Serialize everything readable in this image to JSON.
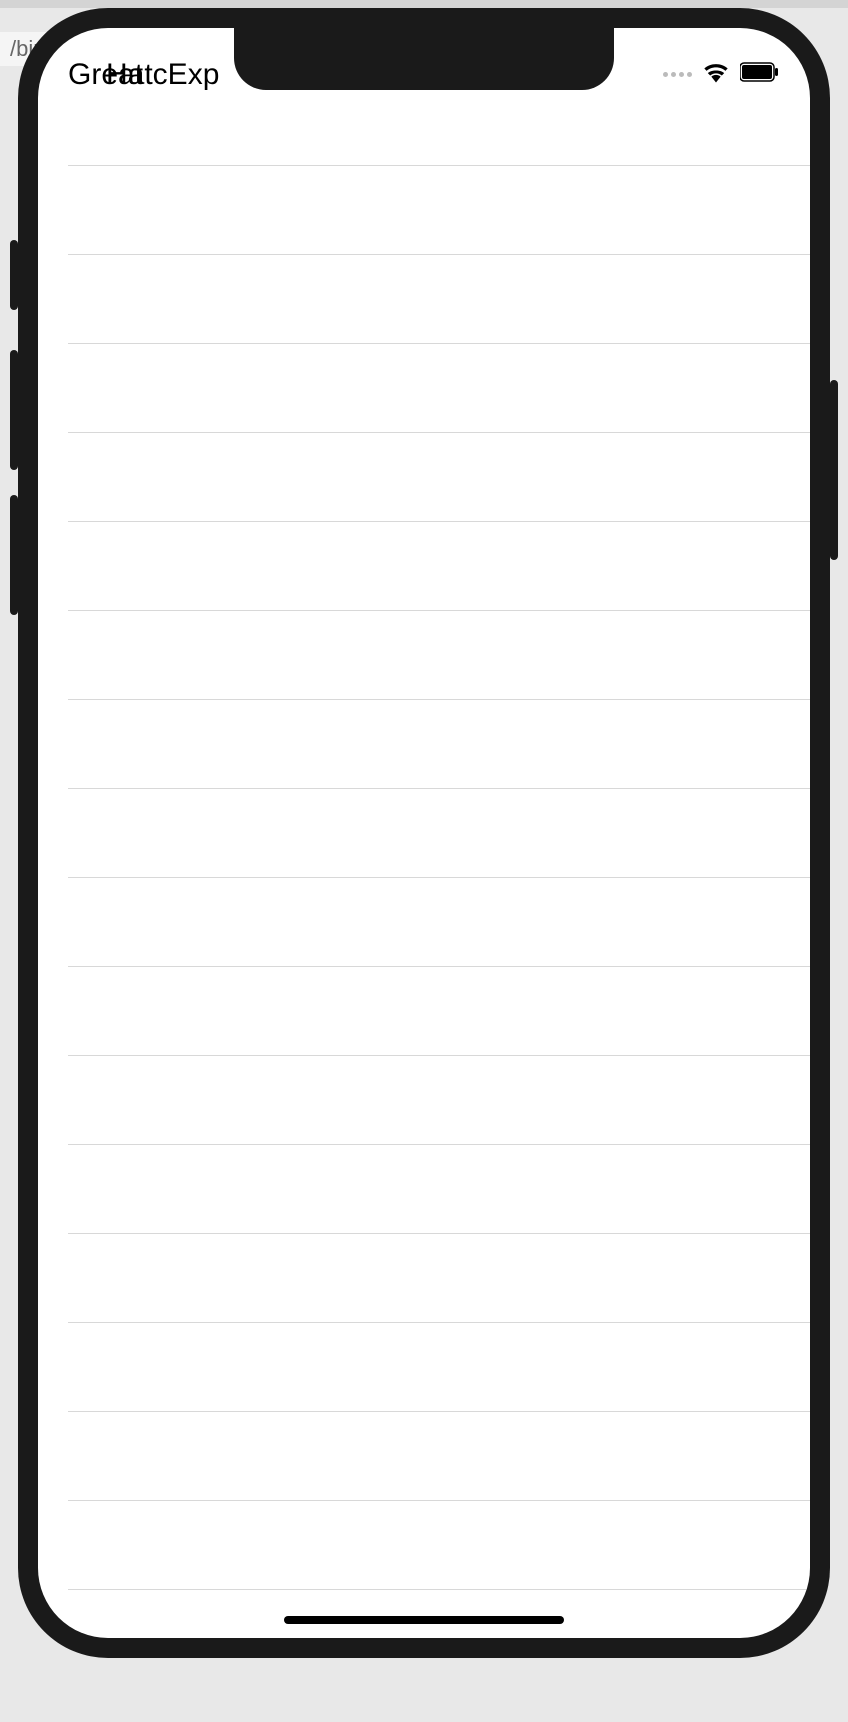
{
  "browser": {
    "url_fragment": "/bim"
  },
  "status_bar": {
    "text_layer_1": "Great",
    "text_layer_2": "HatcExp"
  },
  "table": {
    "rows": [
      {
        "content": ""
      },
      {
        "content": ""
      },
      {
        "content": ""
      },
      {
        "content": ""
      },
      {
        "content": ""
      },
      {
        "content": ""
      },
      {
        "content": ""
      },
      {
        "content": ""
      },
      {
        "content": ""
      },
      {
        "content": ""
      },
      {
        "content": ""
      },
      {
        "content": ""
      },
      {
        "content": ""
      },
      {
        "content": ""
      },
      {
        "content": ""
      },
      {
        "content": ""
      },
      {
        "content": ""
      }
    ]
  }
}
